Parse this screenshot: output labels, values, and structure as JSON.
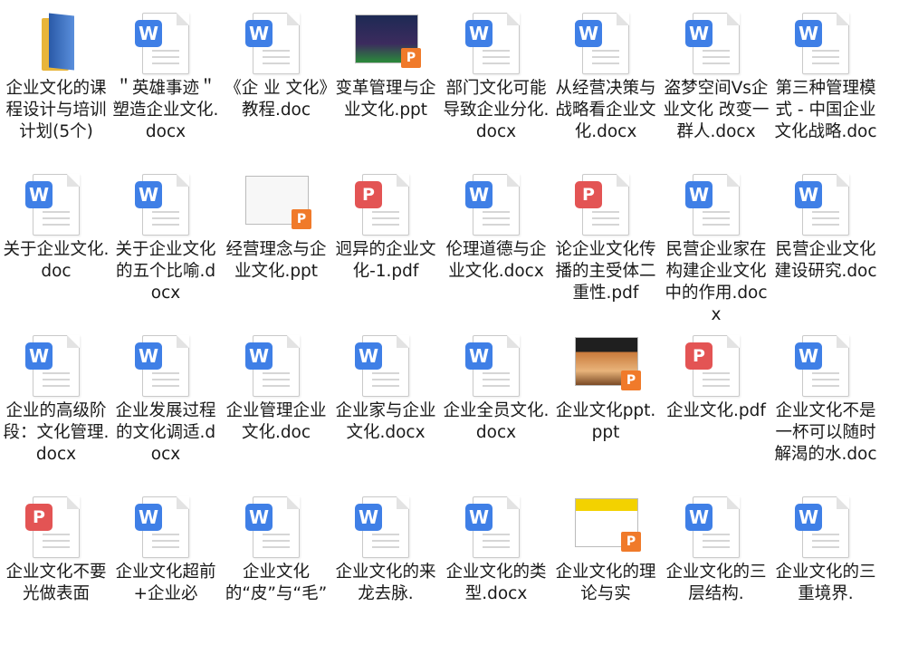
{
  "files": [
    {
      "name": "企业文化的课程设计与培训计划(5个)",
      "type": "folder"
    },
    {
      "name": "＂英雄事迹＂塑造企业文化.docx",
      "type": "docx"
    },
    {
      "name": "《企 业 文化》教程.doc",
      "type": "doc"
    },
    {
      "name": "变革管理与企业文化.ppt",
      "type": "ppt"
    },
    {
      "name": "部门文化可能导致企业分化.docx",
      "type": "docx"
    },
    {
      "name": "从经营决策与战略看企业文化.docx",
      "type": "docx"
    },
    {
      "name": "盗梦空间Vs企业文化 改变一群人.docx",
      "type": "docx"
    },
    {
      "name": "第三种管理模式 - 中国企业文化战略.doc",
      "type": "doc"
    },
    {
      "name": "关于企业文化.doc",
      "type": "doc"
    },
    {
      "name": "关于企业文化的五个比喻.docx",
      "type": "docx"
    },
    {
      "name": "经营理念与企业文化.ppt",
      "type": "ppt"
    },
    {
      "name": "迥异的企业文化-1.pdf",
      "type": "pdf"
    },
    {
      "name": "伦理道德与企业文化.docx",
      "type": "docx"
    },
    {
      "name": "论企业文化传播的主受体二重性.pdf",
      "type": "pdf"
    },
    {
      "name": "民营企业家在构建企业文化中的作用.docx",
      "type": "docx"
    },
    {
      "name": "民营企业文化建设研究.doc",
      "type": "doc"
    },
    {
      "name": "企业的高级阶段：文化管理.docx",
      "type": "docx"
    },
    {
      "name": "企业发展过程的文化调适.docx",
      "type": "docx"
    },
    {
      "name": "企业管理企业文化.doc",
      "type": "doc"
    },
    {
      "name": "企业家与企业文化.docx",
      "type": "docx"
    },
    {
      "name": "企业全员文化.docx",
      "type": "docx"
    },
    {
      "name": "企业文化ppt.ppt",
      "type": "ppt"
    },
    {
      "name": "企业文化.pdf",
      "type": "pdf"
    },
    {
      "name": "企业文化不是一杯可以随时解渴的水.doc",
      "type": "doc"
    },
    {
      "name": "企业文化不要光做表面",
      "type": "pdf"
    },
    {
      "name": "企业文化超前+企业必",
      "type": "doc"
    },
    {
      "name": "企业文化的“皮”与“毛”",
      "type": "docx"
    },
    {
      "name": "企业文化的来龙去脉.",
      "type": "docx"
    },
    {
      "name": "企业文化的类型.docx",
      "type": "docx"
    },
    {
      "name": "企业文化的理论与实",
      "type": "ppt"
    },
    {
      "name": "企业文化的三层结构.",
      "type": "docx"
    },
    {
      "name": "企业文化的三重境界.",
      "type": "docx"
    }
  ],
  "thumb_styles": [
    "dark",
    "light",
    "food",
    "yellow"
  ],
  "colors": {
    "word": "#3f7fe6",
    "pdf": "#e35454",
    "ppt": "#f07a2a",
    "folder": "#e8b53a"
  }
}
